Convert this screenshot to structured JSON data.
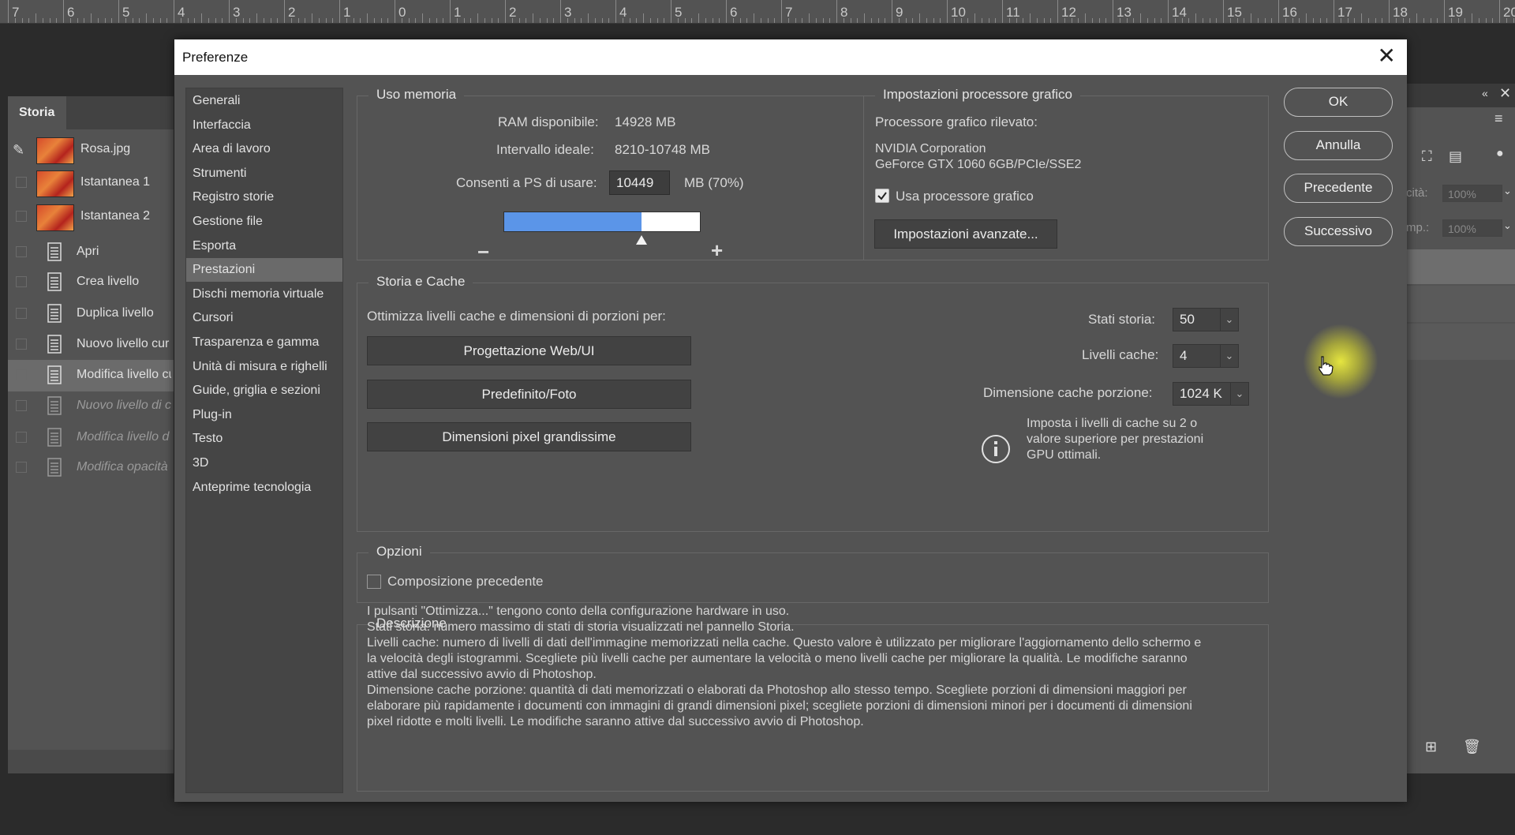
{
  "ruler": {
    "labels": [
      "7",
      "6",
      "5",
      "4",
      "3",
      "2",
      "1",
      "0",
      "1",
      "2",
      "3",
      "4",
      "5",
      "6",
      "7",
      "8",
      "9",
      "10",
      "11",
      "12",
      "13",
      "14",
      "15",
      "16",
      "17",
      "18",
      "19",
      "20"
    ]
  },
  "history_panel": {
    "tab": "Storia",
    "items": [
      {
        "label": "Rosa.jpg",
        "kind": "thumb",
        "state": "normal"
      },
      {
        "label": "Istantanea 1",
        "kind": "thumb",
        "state": "normal"
      },
      {
        "label": "Istantanea 2",
        "kind": "thumb",
        "state": "normal"
      },
      {
        "label": "Apri",
        "kind": "doc",
        "state": "normal"
      },
      {
        "label": "Crea livello",
        "kind": "doc",
        "state": "normal"
      },
      {
        "label": "Duplica livello",
        "kind": "doc",
        "state": "normal"
      },
      {
        "label": "Nuovo livello cur",
        "kind": "doc",
        "state": "normal"
      },
      {
        "label": "Modifica livello cu",
        "kind": "doc",
        "state": "selected"
      },
      {
        "label": "Nuovo livello di c",
        "kind": "doc",
        "state": "dimmed"
      },
      {
        "label": "Modifica livello d",
        "kind": "doc",
        "state": "dimmed"
      },
      {
        "label": "Modifica opacità",
        "kind": "doc",
        "state": "dimmed"
      }
    ]
  },
  "layers_panel": {
    "opacity_label": "cità:",
    "opacity_value": "100%",
    "fill_label": "mp.:",
    "fill_value": "100%"
  },
  "dialog": {
    "title": "Preferenze",
    "close_glyph": "✕",
    "nav": [
      "Generali",
      "Interfaccia",
      "Area di lavoro",
      "Strumenti",
      "Registro storie",
      "Gestione file",
      "Esporta",
      "Prestazioni",
      "Dischi memoria virtuale",
      "Cursori",
      "Trasparenza e gamma",
      "Unità di misura e righelli",
      "Guide, griglia e sezioni",
      "Plug-in",
      "Testo",
      "3D",
      "Anteprime tecnologia"
    ],
    "nav_active": 7,
    "buttons": {
      "ok": "OK",
      "cancel": "Annulla",
      "prev": "Precedente",
      "next": "Successivo"
    },
    "memory": {
      "title": "Uso memoria",
      "ram_label": "RAM disponibile:",
      "ram_value": "14928 MB",
      "ideal_label": "Intervallo ideale:",
      "ideal_value": "8210-10748 MB",
      "allow_label": "Consenti a PS di usare:",
      "allow_value": "10449",
      "allow_suffix": "MB (70%)",
      "slider_fraction": 0.7,
      "minus": "−",
      "plus": "+"
    },
    "gpu": {
      "title": "Impostazioni processore grafico",
      "detected_label": "Processore grafico rilevato:",
      "vendor": "NVIDIA Corporation",
      "model": "GeForce GTX 1060 6GB/PCIe/SSE2",
      "use_gpu_label": "Usa processore grafico",
      "use_gpu_checked": true,
      "advanced_button": "Impostazioni avanzate..."
    },
    "history_cache": {
      "title": "Storia e Cache",
      "optimize_label": "Ottimizza livelli cache e dimensioni di porzioni per:",
      "opt_buttons": [
        "Progettazione Web/UI",
        "Predefinito/Foto",
        "Dimensioni pixel grandissime"
      ],
      "history_states_label": "Stati storia:",
      "history_states_value": "50",
      "cache_levels_label": "Livelli cache:",
      "cache_levels_value": "4",
      "tile_size_label": "Dimensione cache porzione:",
      "tile_size_value": "1024 K",
      "info_line1": "Imposta i livelli di cache su 2 o",
      "info_line2": "valore superiore per prestazioni",
      "info_line3": "GPU ottimali."
    },
    "options": {
      "title": "Opzioni",
      "legacy_label": "Composizione precedente",
      "legacy_checked": false
    },
    "description": {
      "title": "Descrizione",
      "lines": [
        "I pulsanti \"Ottimizza...\" tengono conto della configurazione hardware in uso.",
        "Stati storia: numero massimo di stati di storia visualizzati nel pannello Storia.",
        "Livelli cache: numero di livelli di dati dell'immagine memorizzati nella cache. Questo valore è utilizzato per migliorare l'aggiornamento dello schermo e",
        "la velocità degli istogrammi. Scegliete più livelli cache per aumentare la velocità o meno livelli cache per migliorare la qualità. Le modifiche saranno",
        "attive dal successivo avvio di Photoshop.",
        "Dimensione cache porzione: quantità di dati memorizzati o elaborati da Photoshop allo stesso tempo. Scegliete porzioni di dimensioni maggiori per",
        "elaborare più rapidamente i documenti con immagini di grandi dimensioni pixel; scegliete porzioni di dimensioni minori per i documenti di dimensioni",
        "pixel ridotte e molti livelli. Le modifiche saranno attive dal successivo avvio di Photoshop."
      ]
    }
  }
}
